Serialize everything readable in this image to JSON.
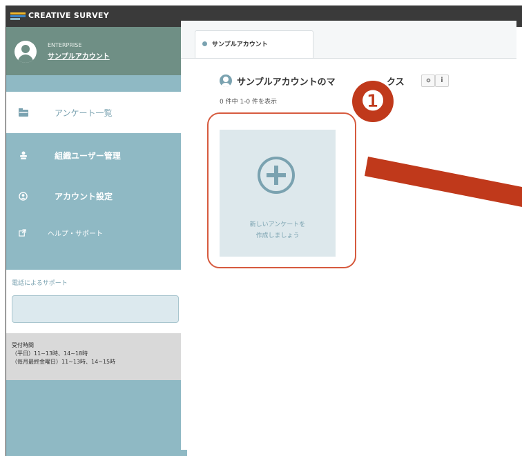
{
  "app": {
    "brand": "CREATIVE SURVEY",
    "logo_colors": [
      "#f0b82a",
      "#3b82c4",
      "#8fb9c4"
    ]
  },
  "sidebar": {
    "plan": "ENTERPRISE",
    "account_name": "サンプルアカウント",
    "items": [
      {
        "label": "アンケート一覧",
        "icon": "folder-icon",
        "active": true
      },
      {
        "label": "組織ユーザー管理",
        "icon": "users-icon"
      },
      {
        "label": "アカウント設定",
        "icon": "account-icon"
      },
      {
        "label": "ヘルプ・サポート",
        "icon": "external-link-icon"
      }
    ],
    "support": {
      "title": "電話によるサポート",
      "hours_title": "受付時間",
      "hours_weekday": "（平日）11~13時、14~18時",
      "hours_last_friday": "（毎月最終金曜日）11~13時、14~15時"
    }
  },
  "main": {
    "tab_label": "サンプルアカウント",
    "mailbox_title": "サンプルアカウントのマ",
    "mailbox_title_tail": "クス",
    "count_text": "0 件中 1-0 件を表示",
    "new_card_line1": "新しいアンケートを",
    "new_card_line2": "作成しましょう",
    "settings_icon": "gear-icon",
    "info_icon": "info-icon",
    "info_glyph": "i"
  },
  "annotation": {
    "badge_number": "❶",
    "color": "#c0391b"
  }
}
